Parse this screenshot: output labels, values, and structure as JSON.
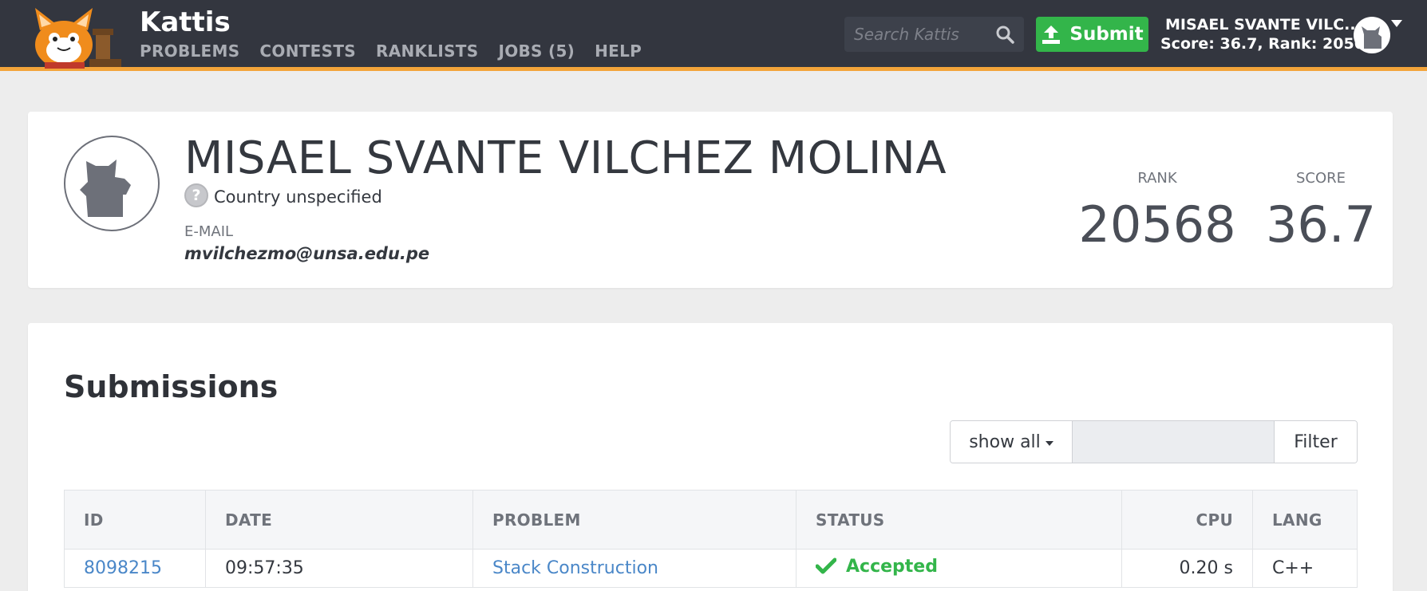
{
  "header": {
    "brand": "Kattis",
    "nav": [
      "PROBLEMS",
      "CONTESTS",
      "RANKLISTS",
      "JOBS (5)",
      "HELP"
    ],
    "search_placeholder": "Search Kattis",
    "submit_label": "Submit",
    "user_name": "MISAEL SVANTE VILC...",
    "user_score": "Score: 36.7, Rank: 20568"
  },
  "profile": {
    "name": "MISAEL SVANTE VILCHEZ MOLINA",
    "country_icon_glyph": "?",
    "country": "Country unspecified",
    "email_label": "E-MAIL",
    "email": "mvilchezmo@unsa.edu.pe",
    "rank_label": "RANK",
    "rank": "20568",
    "score_label": "SCORE",
    "score": "36.7"
  },
  "submissions": {
    "title": "Submissions",
    "filter_select": "show all",
    "filter_button": "Filter",
    "columns": [
      "ID",
      "DATE",
      "PROBLEM",
      "STATUS",
      "CPU",
      "LANG"
    ],
    "rows": [
      {
        "id": "8098215",
        "date": "09:57:35",
        "problem": "Stack Construction",
        "status": "Accepted",
        "cpu": "0.20 s",
        "lang": "C++"
      }
    ]
  },
  "colors": {
    "topbar": "#33363f",
    "accent_stripe": "#f3a43a",
    "submit_green": "#33b54a",
    "link_blue": "#4a87c8"
  }
}
